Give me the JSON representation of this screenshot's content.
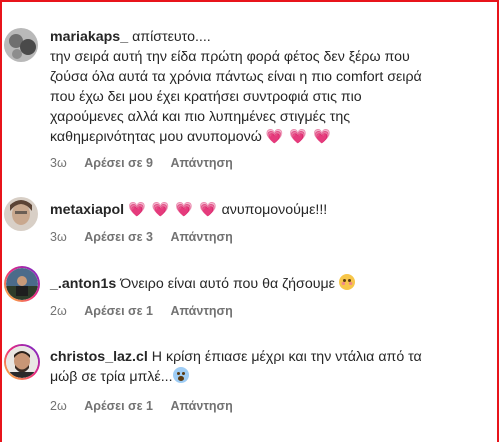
{
  "comments": [
    {
      "username": "mariakaps_",
      "lines": [
        "απίστευτο....",
        "την σειρά αυτή την είδα πρώτη φορά φέτος δεν ξέρω που",
        "ζούσα όλα αυτά τα χρόνια πάντως είναι η πιο comfort σειρά",
        "που έχω δει μου έχει κρατήσει συντροφιά στις πιο",
        "χαρούμενες αλλά και πιο λυπημένες στιγμές της",
        "καθημερινότητας μου ανυπομονώ"
      ],
      "emoji": "💗 💗 💗",
      "time": "3ω",
      "likes": "Αρέσει σε 9",
      "reply": "Απάντηση"
    },
    {
      "username": "metaxiapol",
      "emoji": "💗 💗 💗 💗",
      "text": "ανυπομονούμε!!!",
      "time": "3ω",
      "likes": "Αρέσει σε 3",
      "reply": "Απάντηση"
    },
    {
      "username": "_.anton1s",
      "text": "Όνειρο είναι αυτό που θα ζήσουμε",
      "emoji_icon": "blushing-face-icon",
      "time": "2ω",
      "likes": "Αρέσει σε 1",
      "reply": "Απάντηση"
    },
    {
      "username": "christos_laz.cl",
      "lines": [
        "Η κρίση έπιασε μέχρι και την ντάλια από τα",
        "μώβ σε τρία μπλέ..."
      ],
      "emoji_icon": "screaming-face-icon",
      "time": "2ω",
      "likes": "Αρέσει σε 1",
      "reply": "Απάντηση"
    }
  ],
  "colors": {
    "frame": "#e8141b",
    "text": "#262626",
    "meta": "#737373",
    "heart": "#e8155b"
  }
}
